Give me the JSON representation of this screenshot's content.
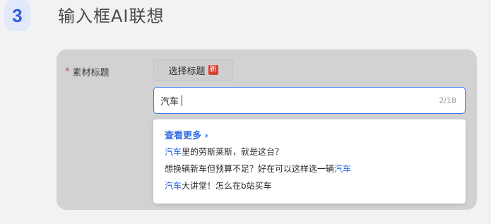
{
  "step": {
    "number": "3",
    "title": "输入框AI联想"
  },
  "form": {
    "required_mark": "*",
    "field_label": "素材标题",
    "choose_button_label": "选择标题",
    "new_tag": "新",
    "input_value": "汽车",
    "char_counter": "2/18"
  },
  "suggestions": {
    "see_more": "查看更多 ›",
    "items": [
      {
        "before": "",
        "keyword": "汽车",
        "after": "里的劳斯莱斯，就是这台？"
      },
      {
        "before": "想换辆新车但预算不足？好在可以这样选一辆",
        "keyword": "汽车",
        "after": ""
      },
      {
        "before": "",
        "keyword": "汽车",
        "after": "大讲堂！怎么在b站买车"
      }
    ]
  },
  "colors": {
    "accent": "#2f6ae6",
    "input_border": "#3a7bf5",
    "required": "#e0443a",
    "new_tag_bg": "#d8402f",
    "panel_bg": "#d2d2d2",
    "badge_bg": "#e2e9fb"
  }
}
